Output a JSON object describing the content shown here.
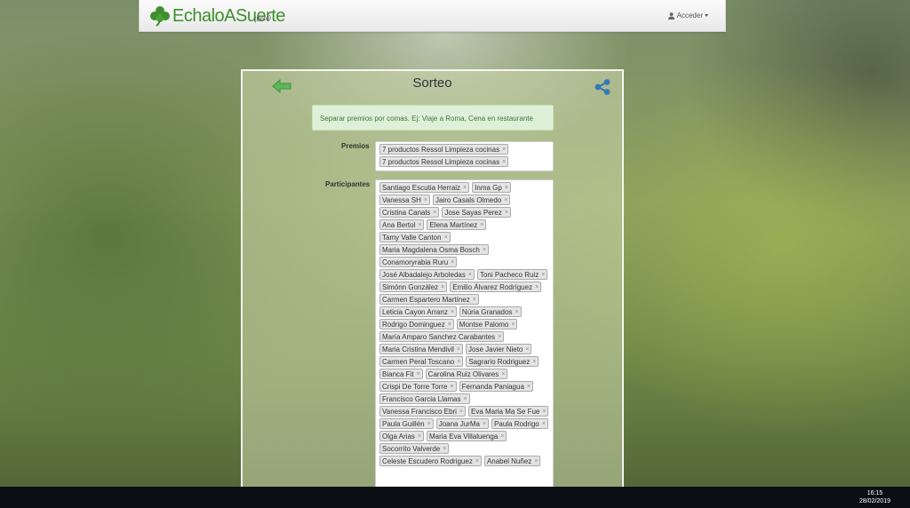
{
  "navbar": {
    "brand": "EchaloASuerte",
    "beta": "(Beta)",
    "login_label": "Acceder"
  },
  "panel": {
    "title": "Sorteo",
    "hint": "Separar premios por comas. Ej: Viaje a Roma, Cena en restaurante",
    "prizes_label": "Premios",
    "participants_label": "Participantes",
    "remove_symbol": "×",
    "prizes": [
      "7 productos Ressol Limpieza cocinas",
      "7 productos Ressol Limpieza cocinas"
    ],
    "participants": [
      "Santiago Escutia Herraiz",
      "Inma Gp",
      "Vanessa SH",
      "Jairo Casals Olmedo",
      "Cristina Canals",
      "Jose Sayas Perez",
      "Ana Bertol",
      "Elena Martínez",
      "Tamy Valle Canton",
      "Maria Magdalena Osma Bosch",
      "Conamoryrabia Ruru",
      "José Albadalejo Arboledas",
      "Toni Pacheco Ruiz",
      "Simónn González",
      "Emilio Álvarez Rodríguez",
      "Carmen Espartero Martínez",
      "Leticia Cayon Arranz",
      "Núria Granados",
      "Rodrigo Dominguez",
      "Montse Palomo",
      "María Amparo Sanchez Carabantes",
      "Maria Cristina Mendivil",
      "Jose Javier Nieto",
      "Carmen Peral Toscano",
      "Sagrario Rodriguez",
      "Bianca Fit",
      "Carolina Ruiz Olivares",
      "Crispi De Torre Torre",
      "Fernanda Paniagua",
      "Francisco Garcia Llamas",
      "Vanessa Francisco Ebri",
      "Eva Maria Ma Se Fue",
      "Paula Guillén",
      "Joana JurMa",
      "Paula Rodrigo",
      "Olga Arias",
      "Maria Eva Villaluenga",
      "Socorrito Valverde",
      "Celeste Escudero Rodriguez",
      "Anabel Nuñez"
    ]
  },
  "taskbar": {
    "time": "16:15",
    "date": "28/02/2019"
  },
  "colors": {
    "brand_green": "#3f8f2e",
    "back_arrow": "#5cb85c",
    "share_icon": "#337ab7",
    "hint_bg": "#dff0d8",
    "hint_text": "#3c763d"
  },
  "icons": {
    "logo": "clover-icon",
    "login": "user-icon",
    "back": "arrow-left-icon",
    "share": "share-icon"
  }
}
